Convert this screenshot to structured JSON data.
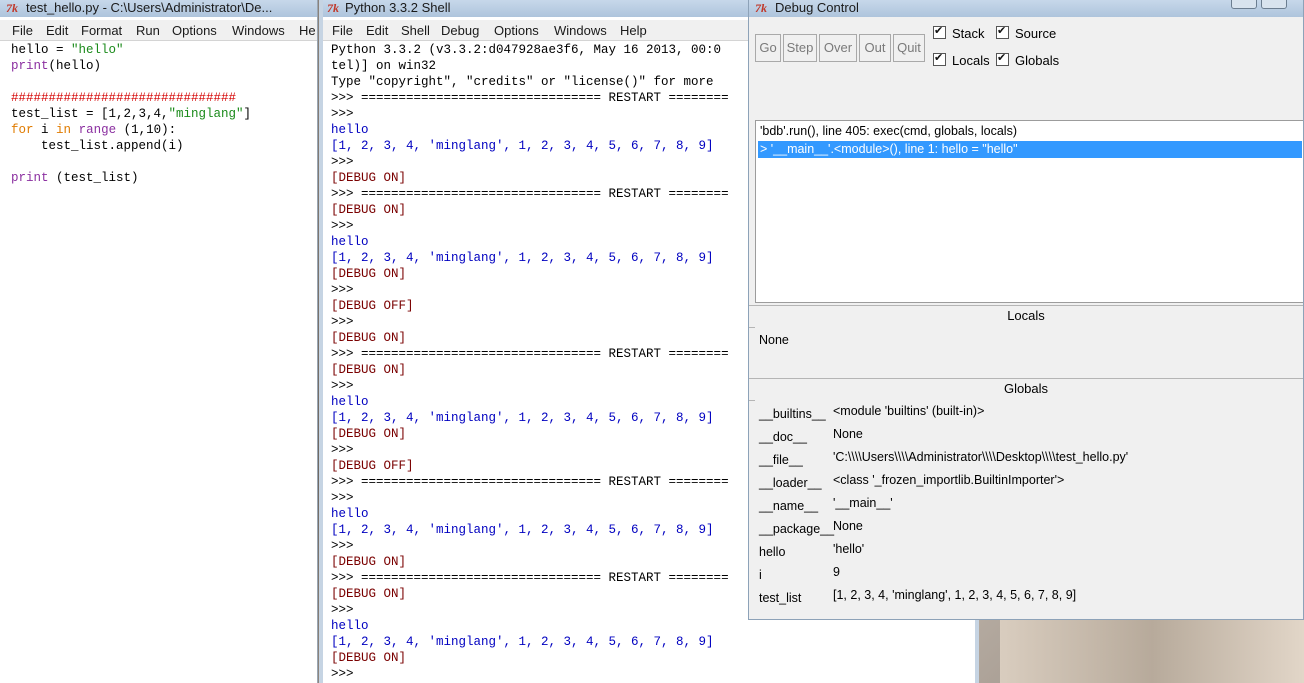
{
  "editor": {
    "title": "test_hello.py - C:\\Users\\Administrator\\De...",
    "menu": [
      "File",
      "Edit",
      "Format",
      "Run",
      "Options",
      "Windows",
      "He"
    ],
    "lines": [
      [
        {
          "t": "hello = ",
          "c": ""
        },
        {
          "t": "\"hello\"",
          "c": "str"
        }
      ],
      [
        {
          "t": "print",
          "c": "bi"
        },
        {
          "t": "(hello)",
          "c": ""
        }
      ],
      [
        {
          "t": "",
          "c": ""
        }
      ],
      [
        {
          "t": "##############################",
          "c": "cmt"
        }
      ],
      [
        {
          "t": "test_list = [1,2,3,4,",
          "c": ""
        },
        {
          "t": "\"minglang\"",
          "c": "str"
        },
        {
          "t": "]",
          "c": ""
        }
      ],
      [
        {
          "t": "for",
          "c": "kw"
        },
        {
          "t": " i ",
          "c": ""
        },
        {
          "t": "in",
          "c": "kw"
        },
        {
          "t": " ",
          "c": ""
        },
        {
          "t": "range",
          "c": "bi"
        },
        {
          "t": " (1,10):",
          "c": ""
        }
      ],
      [
        {
          "t": "    test_list.append(i)",
          "c": ""
        }
      ],
      [
        {
          "t": "",
          "c": ""
        }
      ],
      [
        {
          "t": "print",
          "c": "bi"
        },
        {
          "t": " (test_list)",
          "c": ""
        }
      ]
    ]
  },
  "shell": {
    "title": "Python 3.3.2 Shell",
    "menu": [
      "File",
      "Edit",
      "Shell",
      "Debug",
      "Options",
      "Windows",
      "Help"
    ],
    "lines": [
      [
        {
          "t": "Python 3.3.2 (v3.3.2:d047928ae3f6, May 16 2013, 00:0",
          "c": ""
        }
      ],
      [
        {
          "t": "tel)] on win32",
          "c": ""
        }
      ],
      [
        {
          "t": "Type \"copyright\", \"credits\" or \"license()\" for more",
          "c": ""
        }
      ],
      [
        {
          "t": ">>> ================================ RESTART ========",
          "c": ""
        }
      ],
      [
        {
          "t": ">>>",
          "c": ""
        }
      ],
      [
        {
          "t": "hello",
          "c": "out"
        }
      ],
      [
        {
          "t": "[1, 2, 3, 4, 'minglang', 1, 2, 3, 4, 5, 6, 7, 8, 9]",
          "c": "out"
        }
      ],
      [
        {
          "t": ">>>",
          "c": ""
        }
      ],
      [
        {
          "t": "[DEBUG ON]",
          "c": "debug"
        }
      ],
      [
        {
          "t": ">>> ================================ RESTART ========",
          "c": ""
        }
      ],
      [
        {
          "t": "[DEBUG ON]",
          "c": "debug"
        }
      ],
      [
        {
          "t": ">>>",
          "c": ""
        }
      ],
      [
        {
          "t": "hello",
          "c": "out"
        }
      ],
      [
        {
          "t": "[1, 2, 3, 4, 'minglang', 1, 2, 3, 4, 5, 6, 7, 8, 9]",
          "c": "out"
        }
      ],
      [
        {
          "t": "[DEBUG ON]",
          "c": "debug"
        }
      ],
      [
        {
          "t": ">>>",
          "c": ""
        }
      ],
      [
        {
          "t": "[DEBUG OFF]",
          "c": "debug"
        }
      ],
      [
        {
          "t": ">>>",
          "c": ""
        }
      ],
      [
        {
          "t": "[DEBUG ON]",
          "c": "debug"
        }
      ],
      [
        {
          "t": ">>> ================================ RESTART ========",
          "c": ""
        }
      ],
      [
        {
          "t": "[DEBUG ON]",
          "c": "debug"
        }
      ],
      [
        {
          "t": ">>>",
          "c": ""
        }
      ],
      [
        {
          "t": "hello",
          "c": "out"
        }
      ],
      [
        {
          "t": "[1, 2, 3, 4, 'minglang', 1, 2, 3, 4, 5, 6, 7, 8, 9]",
          "c": "out"
        }
      ],
      [
        {
          "t": "[DEBUG ON]",
          "c": "debug"
        }
      ],
      [
        {
          "t": ">>>",
          "c": ""
        }
      ],
      [
        {
          "t": "[DEBUG OFF]",
          "c": "debug"
        }
      ],
      [
        {
          "t": ">>> ================================ RESTART ========",
          "c": ""
        }
      ],
      [
        {
          "t": ">>>",
          "c": ""
        }
      ],
      [
        {
          "t": "hello",
          "c": "out"
        }
      ],
      [
        {
          "t": "[1, 2, 3, 4, 'minglang', 1, 2, 3, 4, 5, 6, 7, 8, 9]",
          "c": "out"
        }
      ],
      [
        {
          "t": ">>>",
          "c": ""
        }
      ],
      [
        {
          "t": "[DEBUG ON]",
          "c": "debug"
        }
      ],
      [
        {
          "t": ">>> ================================ RESTART ========",
          "c": ""
        }
      ],
      [
        {
          "t": "[DEBUG ON]",
          "c": "debug"
        }
      ],
      [
        {
          "t": ">>>",
          "c": ""
        }
      ],
      [
        {
          "t": "hello",
          "c": "out"
        }
      ],
      [
        {
          "t": "[1, 2, 3, 4, 'minglang', 1, 2, 3, 4, 5, 6, 7, 8, 9]",
          "c": "out"
        }
      ],
      [
        {
          "t": "[DEBUG ON]",
          "c": "debug"
        }
      ],
      [
        {
          "t": ">>>",
          "c": ""
        }
      ]
    ]
  },
  "debug": {
    "title": "Debug Control",
    "buttons": {
      "go": "Go",
      "step": "Step",
      "over": "Over",
      "out": "Out",
      "quit": "Quit"
    },
    "checks": {
      "stack": "Stack",
      "source": "Source",
      "locals": "Locals",
      "globals": "Globals"
    },
    "stack": [
      "'bdb'.run(), line 405: exec(cmd, globals, locals)",
      "> '__main__'.<module>(), line 1: hello = \"hello\""
    ],
    "locals_header": "Locals",
    "locals_value": "None",
    "globals_header": "Globals",
    "globals": [
      {
        "name": "__builtins__",
        "value": "<module 'builtins' (built-in)>"
      },
      {
        "name": "__doc__",
        "value": "None"
      },
      {
        "name": "__file__",
        "value": "'C:\\\\\\\\Users\\\\\\\\Administrator\\\\\\\\Desktop\\\\\\\\test_hello.py'"
      },
      {
        "name": "__loader__",
        "value": "<class '_frozen_importlib.BuiltinImporter'>"
      },
      {
        "name": "__name__",
        "value": "'__main__'"
      },
      {
        "name": "__package__",
        "value": "None"
      },
      {
        "name": "hello",
        "value": "'hello'"
      },
      {
        "name": "i",
        "value": "9"
      },
      {
        "name": "test_list",
        "value": "[1, 2, 3, 4, 'minglang', 1, 2, 3, 4, 5, 6, 7, 8, 9]"
      }
    ]
  },
  "tk_icon": "7k"
}
